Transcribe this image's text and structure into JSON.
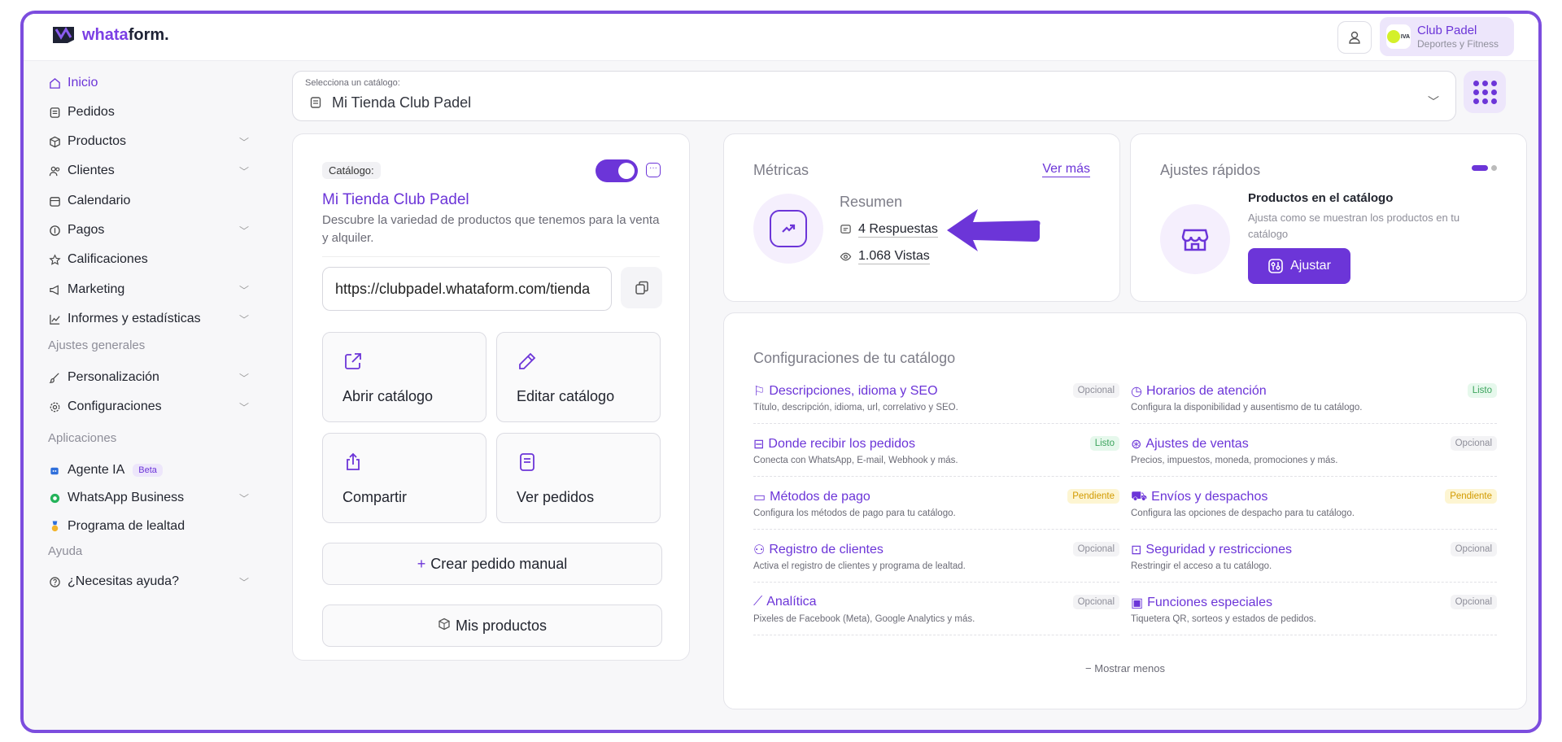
{
  "brand": {
    "name_part1": "whata",
    "name_part2": "form."
  },
  "account": {
    "name": "Club Padel",
    "subtitle": "Deportes y Fitness",
    "logo_text": "IVA"
  },
  "sidebar": {
    "items": [
      {
        "label": "Inicio",
        "icon": "home-icon"
      },
      {
        "label": "Pedidos",
        "icon": "receipt-icon"
      },
      {
        "label": "Productos",
        "icon": "box-icon"
      },
      {
        "label": "Clientes",
        "icon": "users-icon"
      },
      {
        "label": "Calendario",
        "icon": "calendar-icon"
      },
      {
        "label": "Pagos",
        "icon": "coin-icon"
      },
      {
        "label": "Calificaciones",
        "icon": "star-icon"
      },
      {
        "label": "Marketing",
        "icon": "megaphone-icon"
      },
      {
        "label": "Informes y estadísticas",
        "icon": "chart-icon"
      }
    ],
    "section_general": "Ajustes generales",
    "general_items": [
      {
        "label": "Personalización",
        "icon": "brush-icon"
      },
      {
        "label": "Configuraciones",
        "icon": "gear-icon"
      }
    ],
    "section_apps": "Aplicaciones",
    "app_items": [
      {
        "label": "Agente IA",
        "badge": "Beta",
        "icon": "robot-icon"
      },
      {
        "label": "WhatsApp Business",
        "icon": "whatsapp-icon"
      },
      {
        "label": "Programa de lealtad",
        "icon": "medal-icon"
      }
    ],
    "section_help": "Ayuda",
    "help_items": [
      {
        "label": "¿Necesitas ayuda?",
        "icon": "help-icon"
      }
    ]
  },
  "catalog_select": {
    "label": "Selecciona un catálogo:",
    "value": "Mi Tienda Club Padel"
  },
  "catalog_card": {
    "tag": "Catálogo:",
    "name": "Mi Tienda Club Padel",
    "description": "Descubre la variedad de productos que tenemos para la venta y alquiler.",
    "url": "https://clubpadel.whataform.com/tienda",
    "enabled": true,
    "actions": [
      "Abrir catálogo",
      "Editar catálogo",
      "Compartir",
      "Ver pedidos"
    ],
    "create_order": "Crear pedido manual",
    "my_products": "Mis productos"
  },
  "metrics": {
    "title": "Métricas",
    "see_more": "Ver más",
    "summary": "Resumen",
    "responses": "4 Respuestas",
    "views": "1.068 Vistas"
  },
  "quick_settings": {
    "title": "Ajustes rápidos",
    "item_title": "Productos en el catálogo",
    "item_desc": "Ajusta como se muestran los productos en tu catálogo",
    "button": "Ajustar"
  },
  "config": {
    "title": "Configuraciones de tu catálogo",
    "show_less": "Mostrar menos",
    "items": [
      {
        "name": "Descripciones, idioma y SEO",
        "sub": "Título, descripción, idioma, url, correlativo y SEO.",
        "status": "Opcional",
        "icon": "flag-icon"
      },
      {
        "name": "Horarios de atención",
        "sub": "Configura la disponibilidad y ausentismo de tu catálogo.",
        "status": "Listo",
        "icon": "clock-icon"
      },
      {
        "name": "Donde recibir los pedidos",
        "sub": "Conecta con WhatsApp, E-mail, Webhook y más.",
        "status": "Listo",
        "icon": "inbox-icon"
      },
      {
        "name": "Ajustes de ventas",
        "sub": "Precios, impuestos, moneda, promociones y más.",
        "status": "Opcional",
        "icon": "coin-icon"
      },
      {
        "name": "Métodos de pago",
        "sub": "Configura los métodos de pago para tu catálogo.",
        "status": "Pendiente",
        "icon": "card-icon"
      },
      {
        "name": "Envíos y despachos",
        "sub": "Configura las opciones de despacho para tu catálogo.",
        "status": "Pendiente",
        "icon": "truck-icon"
      },
      {
        "name": "Registro de clientes",
        "sub": "Activa el registro de clientes y programa de lealtad.",
        "status": "Opcional",
        "icon": "users-icon"
      },
      {
        "name": "Seguridad y restricciones",
        "sub": "Restringir el acceso a tu catálogo.",
        "status": "Opcional",
        "icon": "lock-icon"
      },
      {
        "name": "Analítica",
        "sub": "Pixeles de Facebook (Meta), Google Analytics y más.",
        "status": "Opcional",
        "icon": "chart-icon"
      },
      {
        "name": "Funciones especiales",
        "sub": "Tiquetera QR, sorteos y estados de pedidos.",
        "status": "Opcional",
        "icon": "calendar-icon"
      }
    ]
  },
  "colors": {
    "accent": "#6c35d8",
    "frame": "#7c4dde",
    "listo": "#3ca45d",
    "pendiente": "#d29a00"
  }
}
